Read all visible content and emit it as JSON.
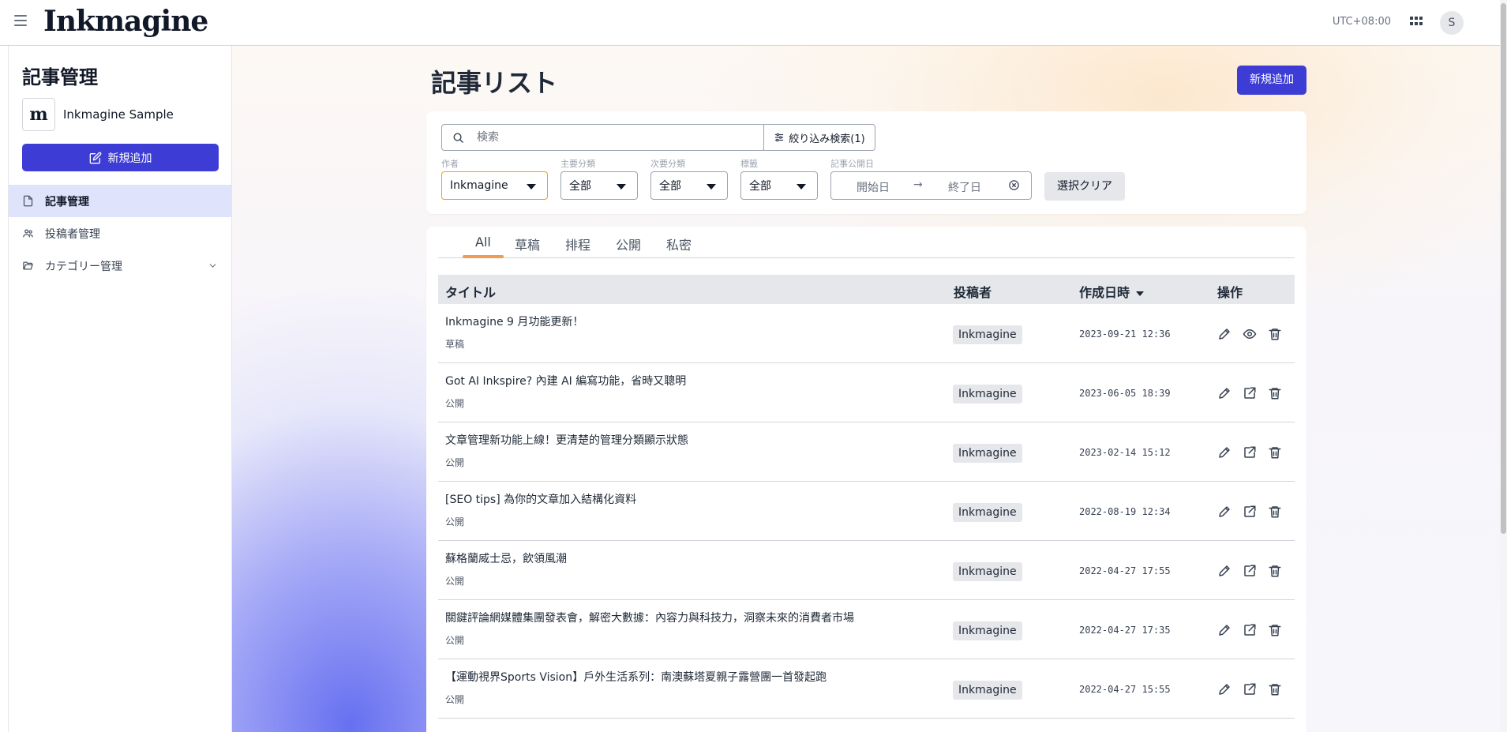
{
  "header": {
    "logo_text": "Inkmagine",
    "timezone": "UTC+08:00",
    "avatar_initial": "S"
  },
  "sidebar": {
    "title": "記事管理",
    "site_logo_text": "m",
    "site_name": "Inkmagine Sample",
    "add_button": "新規追加",
    "items": [
      {
        "label": "記事管理",
        "icon": "document-icon",
        "active": true
      },
      {
        "label": "投稿者管理",
        "icon": "users-icon",
        "active": false
      },
      {
        "label": "カテゴリー管理",
        "icon": "folder-icon",
        "active": false
      }
    ]
  },
  "main": {
    "title": "記事リスト",
    "new_button": "新規追加",
    "search": {
      "placeholder": "検索",
      "advanced_label": "絞り込み検索(1)"
    },
    "filters": {
      "author": {
        "label": "作者",
        "value": "Inkmagine"
      },
      "primary_category": {
        "label": "主要分類",
        "value": "全部"
      },
      "secondary_category": {
        "label": "次要分類",
        "value": "全部"
      },
      "tag": {
        "label": "標籤",
        "value": "全部"
      },
      "publish_date": {
        "label": "記事公開日",
        "start_placeholder": "開始日",
        "arrow": "→",
        "end_placeholder": "終了日"
      },
      "clear_button": "選択クリア"
    },
    "tabs": [
      "All",
      "草稿",
      "排程",
      "公開",
      "私密"
    ],
    "active_tab": "All",
    "table": {
      "columns": {
        "title": "タイトル",
        "author": "投稿者",
        "created": "作成日時",
        "actions": "操作"
      },
      "rows": [
        {
          "title": "Inkmagine 9 月功能更新！",
          "status": "草稿",
          "author": "Inkmagine",
          "created": "2023-09-21 12:36",
          "actions": [
            "edit-icon",
            "eye-icon",
            "trash-icon"
          ]
        },
        {
          "title": "Got AI Inkspire? 內建 AI 編寫功能，省時又聰明",
          "status": "公開",
          "author": "Inkmagine",
          "created": "2023-06-05 18:39",
          "actions": [
            "edit-icon",
            "external-link-icon",
            "trash-icon"
          ]
        },
        {
          "title": "文章管理新功能上線！更清楚的管理分類顯示狀態",
          "status": "公開",
          "author": "Inkmagine",
          "created": "2023-02-14 15:12",
          "actions": [
            "edit-icon",
            "external-link-icon",
            "trash-icon"
          ]
        },
        {
          "title": "[SEO tips] 為你的文章加入結構化資料",
          "status": "公開",
          "author": "Inkmagine",
          "created": "2022-08-19 12:34",
          "actions": [
            "edit-icon",
            "external-link-icon",
            "trash-icon"
          ]
        },
        {
          "title": "蘇格蘭威士忌，飲領風潮",
          "status": "公開",
          "author": "Inkmagine",
          "created": "2022-04-27 17:55",
          "actions": [
            "edit-icon",
            "external-link-icon",
            "trash-icon"
          ]
        },
        {
          "title": "關鍵評論網媒體集團發表會，解密大數據：內容力與科技力，洞察未來的消費者市場",
          "status": "公開",
          "author": "Inkmagine",
          "created": "2022-04-27 17:35",
          "actions": [
            "edit-icon",
            "external-link-icon",
            "trash-icon"
          ]
        },
        {
          "title": "【運動視界Sports Vision】戶外生活系列：南澳蘇塔夏親子露營團一首發起跑",
          "status": "公開",
          "author": "Inkmagine",
          "created": "2022-04-27 15:55",
          "actions": [
            "edit-icon",
            "external-link-icon",
            "trash-icon"
          ]
        }
      ]
    }
  },
  "colors": {
    "accent": "#3d3dd6",
    "tab_indicator": "#ef9b51",
    "active_nav_bg": "#dfe3fb"
  }
}
